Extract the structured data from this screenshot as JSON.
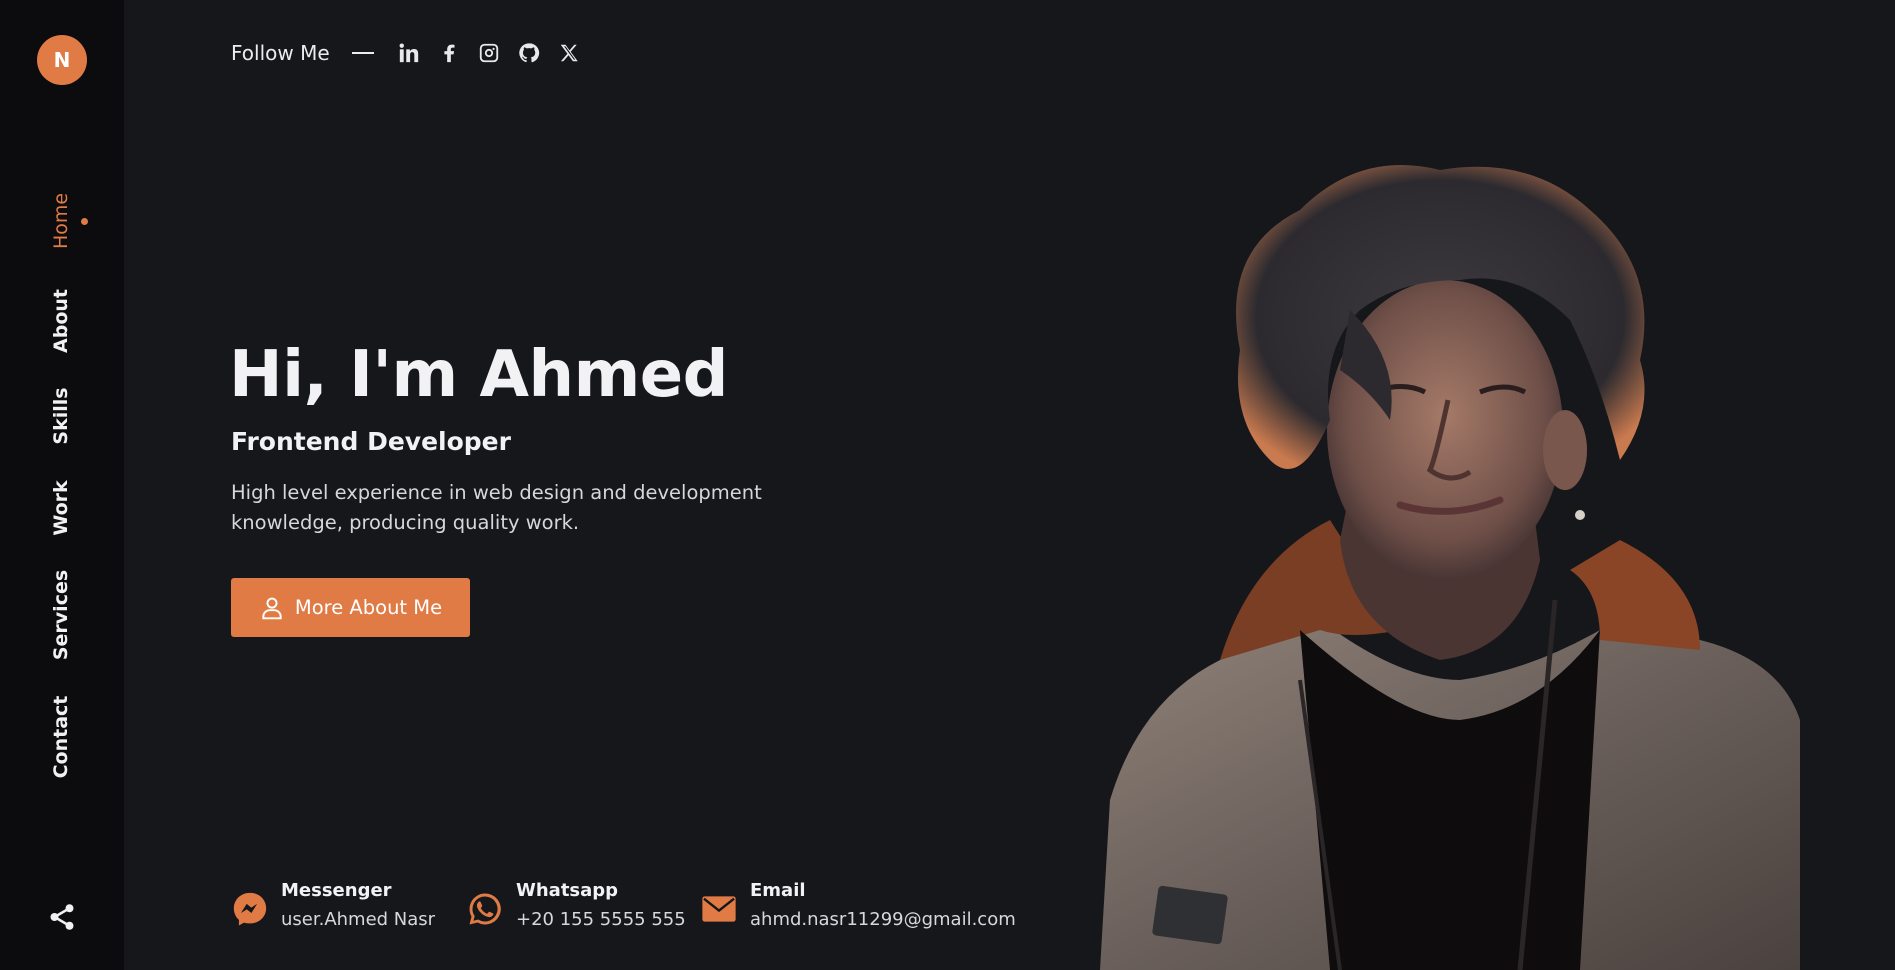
{
  "sidebar": {
    "logo_letter": "N",
    "nav": [
      {
        "label": "Home",
        "active": true
      },
      {
        "label": "About"
      },
      {
        "label": "Skills"
      },
      {
        "label": "Work"
      },
      {
        "label": "Services"
      },
      {
        "label": "Contact"
      }
    ],
    "share_icon": "share-icon"
  },
  "follow": {
    "label": "Follow Me",
    "socials": [
      "linkedin-icon",
      "facebook-icon",
      "instagram-icon",
      "github-icon",
      "x-icon"
    ]
  },
  "hero": {
    "title": "Hi, I'm Ahmed",
    "role": "Frontend Developer",
    "description": "High level experience in web design and development knowledge, producing quality work.",
    "cta_label": "More About Me"
  },
  "contacts": [
    {
      "title": "Messenger",
      "value": "user.Ahmed Nasr",
      "icon": "messenger-icon"
    },
    {
      "title": "Whatsapp",
      "value": "+20 155 5555 555",
      "icon": "whatsapp-icon"
    },
    {
      "title": "Email",
      "value": "ahmd.nasr11299@gmail.com",
      "icon": "email-icon"
    }
  ],
  "colors": {
    "accent": "#e07b45",
    "background": "#16171b",
    "sidebar": "#0c0c0f"
  }
}
